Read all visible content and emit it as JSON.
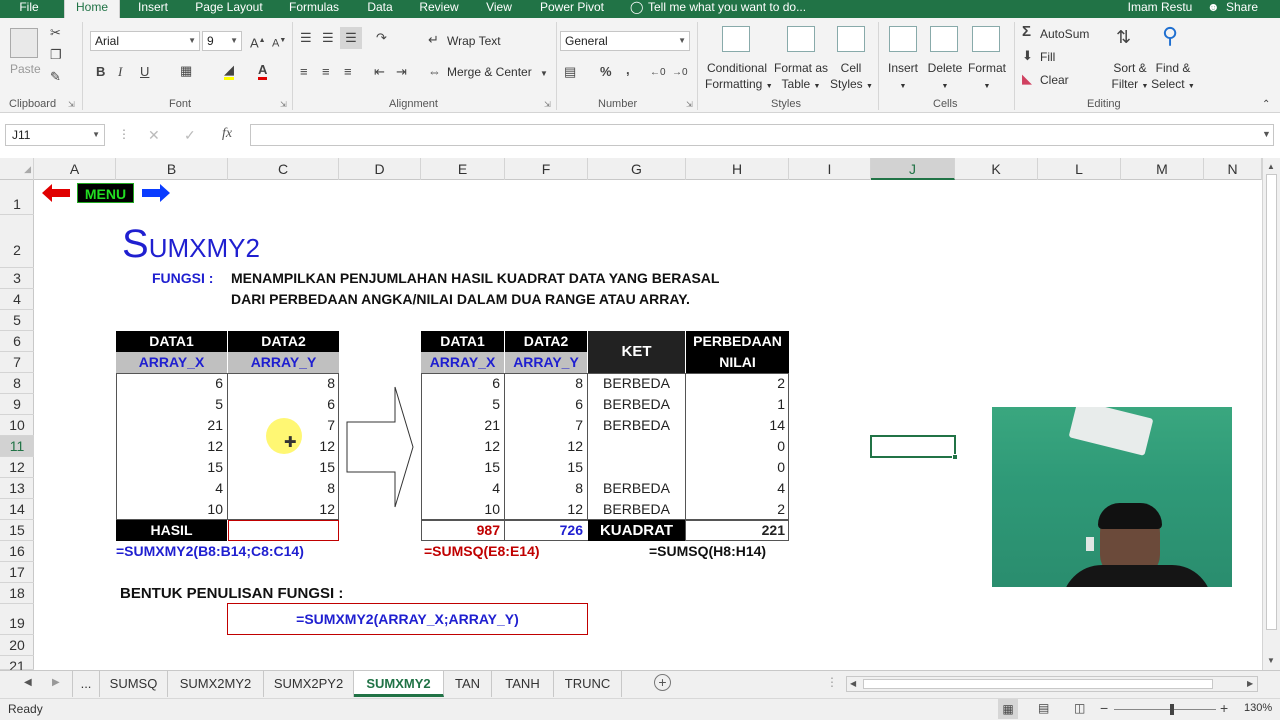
{
  "ribbon_tabs": [
    "File",
    "Home",
    "Insert",
    "Page Layout",
    "Formulas",
    "Data",
    "Review",
    "View",
    "Power Pivot",
    "Tell me what you want to do..."
  ],
  "user": "Imam Restu",
  "share": "Share",
  "clipboard": {
    "paste": "Paste",
    "label": "Clipboard"
  },
  "font": {
    "name": "Arial",
    "size": "9",
    "bold": "B",
    "italic": "I",
    "underline": "U",
    "label": "Font"
  },
  "alignment": {
    "wrap_text": "Wrap Text",
    "merge_center": "Merge & Center",
    "label": "Alignment"
  },
  "number": {
    "format": "General",
    "percent": "%",
    "comma": ",",
    "label": "Number"
  },
  "styles": {
    "conditional": "Conditional",
    "conditional2": "Formatting",
    "format_as": "Format as",
    "format_as2": "Table",
    "cell": "Cell",
    "cell2": "Styles",
    "label": "Styles"
  },
  "cells": {
    "insert": "Insert",
    "delete": "Delete",
    "format": "Format",
    "label": "Cells"
  },
  "editing": {
    "autosum": "AutoSum",
    "fill": "Fill",
    "clear": "Clear",
    "sort": "Sort &",
    "sort2": "Filter",
    "find": "Find &",
    "find2": "Select",
    "label": "Editing"
  },
  "formula_bar": {
    "name_box": "J11",
    "fx": "fx",
    "value": ""
  },
  "columns": [
    "A",
    "B",
    "C",
    "D",
    "E",
    "F",
    "G",
    "H",
    "I",
    "J",
    "K",
    "L",
    "M",
    "N"
  ],
  "rows": [
    "1",
    "2",
    "3",
    "4",
    "5",
    "6",
    "7",
    "8",
    "9",
    "10",
    "11",
    "12",
    "13",
    "14",
    "15",
    "16",
    "17",
    "18",
    "19",
    "20",
    "21"
  ],
  "sheet": {
    "menu_button": "MENU",
    "title_big": "S",
    "title_rest": "UMXMY2",
    "fungsi_label": "FUNGSI :",
    "fungsi_line1": "MENAMPILKAN PENJUMLAHAN HASIL KUADRAT DATA YANG BERASAL",
    "fungsi_line2": "DARI PERBEDAAN ANGKA/NILAI DALAM DUA RANGE ATAU ARRAY.",
    "left_table": {
      "header1": [
        "DATA1",
        "DATA2"
      ],
      "header2": [
        "ARRAY_X",
        "ARRAY_Y"
      ],
      "data1": [
        "6",
        "5",
        "21",
        "12",
        "15",
        "4",
        "10"
      ],
      "data2": [
        "8",
        "6",
        "7",
        "12",
        "15",
        "8",
        "12"
      ],
      "hasil": "HASIL",
      "formula": "=SUMXMY2(B8:B14;C8:C14)"
    },
    "right_table": {
      "header1": [
        "DATA1",
        "DATA2",
        "KET",
        "PERBEDAAN"
      ],
      "header_nilai": "NILAI",
      "header2": [
        "ARRAY_X",
        "ARRAY_Y"
      ],
      "data1": [
        "6",
        "5",
        "21",
        "12",
        "15",
        "4",
        "10"
      ],
      "data2": [
        "8",
        "6",
        "7",
        "12",
        "15",
        "8",
        "12"
      ],
      "ket": [
        "BERBEDA",
        "BERBEDA",
        "BERBEDA",
        "",
        "",
        "BERBEDA",
        "BERBEDA"
      ],
      "nilai": [
        "2",
        "1",
        "14",
        "0",
        "0",
        "4",
        "2"
      ],
      "sum1": "987",
      "sum2": "726",
      "kuadrat": "KUADRAT",
      "sum_nilai": "221",
      "formula1": "=SUMSQ(E8:E14)",
      "formula2": "=SUMSQ(H8:H14)"
    },
    "bentuk_label": "BENTUK PENULISAN FUNGSI :",
    "bentuk_formula": "=SUMXMY2(ARRAY_X;ARRAY_Y)"
  },
  "sheet_tabs": [
    "...",
    "SUMSQ",
    "SUMX2MY2",
    "SUMX2PY2",
    "SUMXMY2",
    "TAN",
    "TANH",
    "TRUNC"
  ],
  "status": {
    "ready": "Ready",
    "zoom": "130%"
  },
  "colors": {
    "excel_green": "#217346",
    "title_blue": "#1f1fd0",
    "red": "#c00000"
  }
}
